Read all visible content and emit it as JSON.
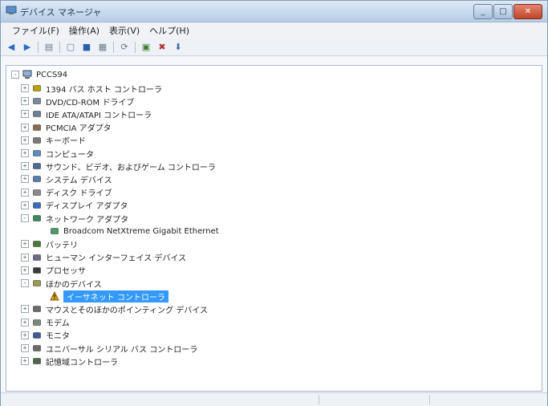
{
  "window": {
    "title": "デバイス マネージャ"
  },
  "menu": [
    {
      "label": "ファイル(F)"
    },
    {
      "label": "操作(A)"
    },
    {
      "label": "表示(V)"
    },
    {
      "label": "ヘルプ(H)"
    }
  ],
  "tree": {
    "root": "PCCS94",
    "items": [
      {
        "label": "1394 バス ホスト コントローラ",
        "icon": "firewire-icon",
        "exp": "+"
      },
      {
        "label": "DVD/CD-ROM ドライブ",
        "icon": "dvd-drive-icon",
        "exp": "+"
      },
      {
        "label": "IDE ATA/ATAPI コントローラ",
        "icon": "ide-controller-icon",
        "exp": "+"
      },
      {
        "label": "PCMCIA アダプタ",
        "icon": "pcmcia-icon",
        "exp": "+"
      },
      {
        "label": "キーボード",
        "icon": "keyboard-icon",
        "exp": "+"
      },
      {
        "label": "コンピュータ",
        "icon": "computer-icon",
        "exp": "+"
      },
      {
        "label": "サウンド、ビデオ、およびゲーム コントローラ",
        "icon": "sound-icon",
        "exp": "+"
      },
      {
        "label": "システム デバイス",
        "icon": "system-device-icon",
        "exp": "+"
      },
      {
        "label": "ディスク ドライブ",
        "icon": "disk-drive-icon",
        "exp": "+"
      },
      {
        "label": "ディスプレイ アダプタ",
        "icon": "display-adapter-icon",
        "exp": "+"
      },
      {
        "label": "ネットワーク アダプタ",
        "icon": "network-adapter-icon",
        "exp": "-"
      },
      {
        "label": "Broadcom NetXtreme Gigabit Ethernet",
        "icon": "network-card-icon",
        "child": true
      },
      {
        "label": "バッテリ",
        "icon": "battery-icon",
        "exp": "+"
      },
      {
        "label": "ヒューマン インターフェイス デバイス",
        "icon": "hid-icon",
        "exp": "+"
      },
      {
        "label": "プロセッサ",
        "icon": "processor-icon",
        "exp": "+"
      },
      {
        "label": "ほかのデバイス",
        "icon": "other-devices-icon",
        "exp": "-"
      },
      {
        "label": "イーサネット コントローラ",
        "icon": "warning-device-icon",
        "child": true,
        "selected": true
      },
      {
        "label": "マウスとそのほかのポインティング デバイス",
        "icon": "mouse-icon",
        "exp": "+"
      },
      {
        "label": "モデム",
        "icon": "modem-icon",
        "exp": "+"
      },
      {
        "label": "モニタ",
        "icon": "monitor-icon",
        "exp": "+"
      },
      {
        "label": "ユニバーサル シリアル バス コントローラ",
        "icon": "usb-icon",
        "exp": "+"
      },
      {
        "label": "記憶域コントローラ",
        "icon": "storage-controller-icon",
        "exp": "+"
      }
    ]
  },
  "colors": {
    "selection": "#3399ff",
    "title_bar": "#c9dbee"
  }
}
